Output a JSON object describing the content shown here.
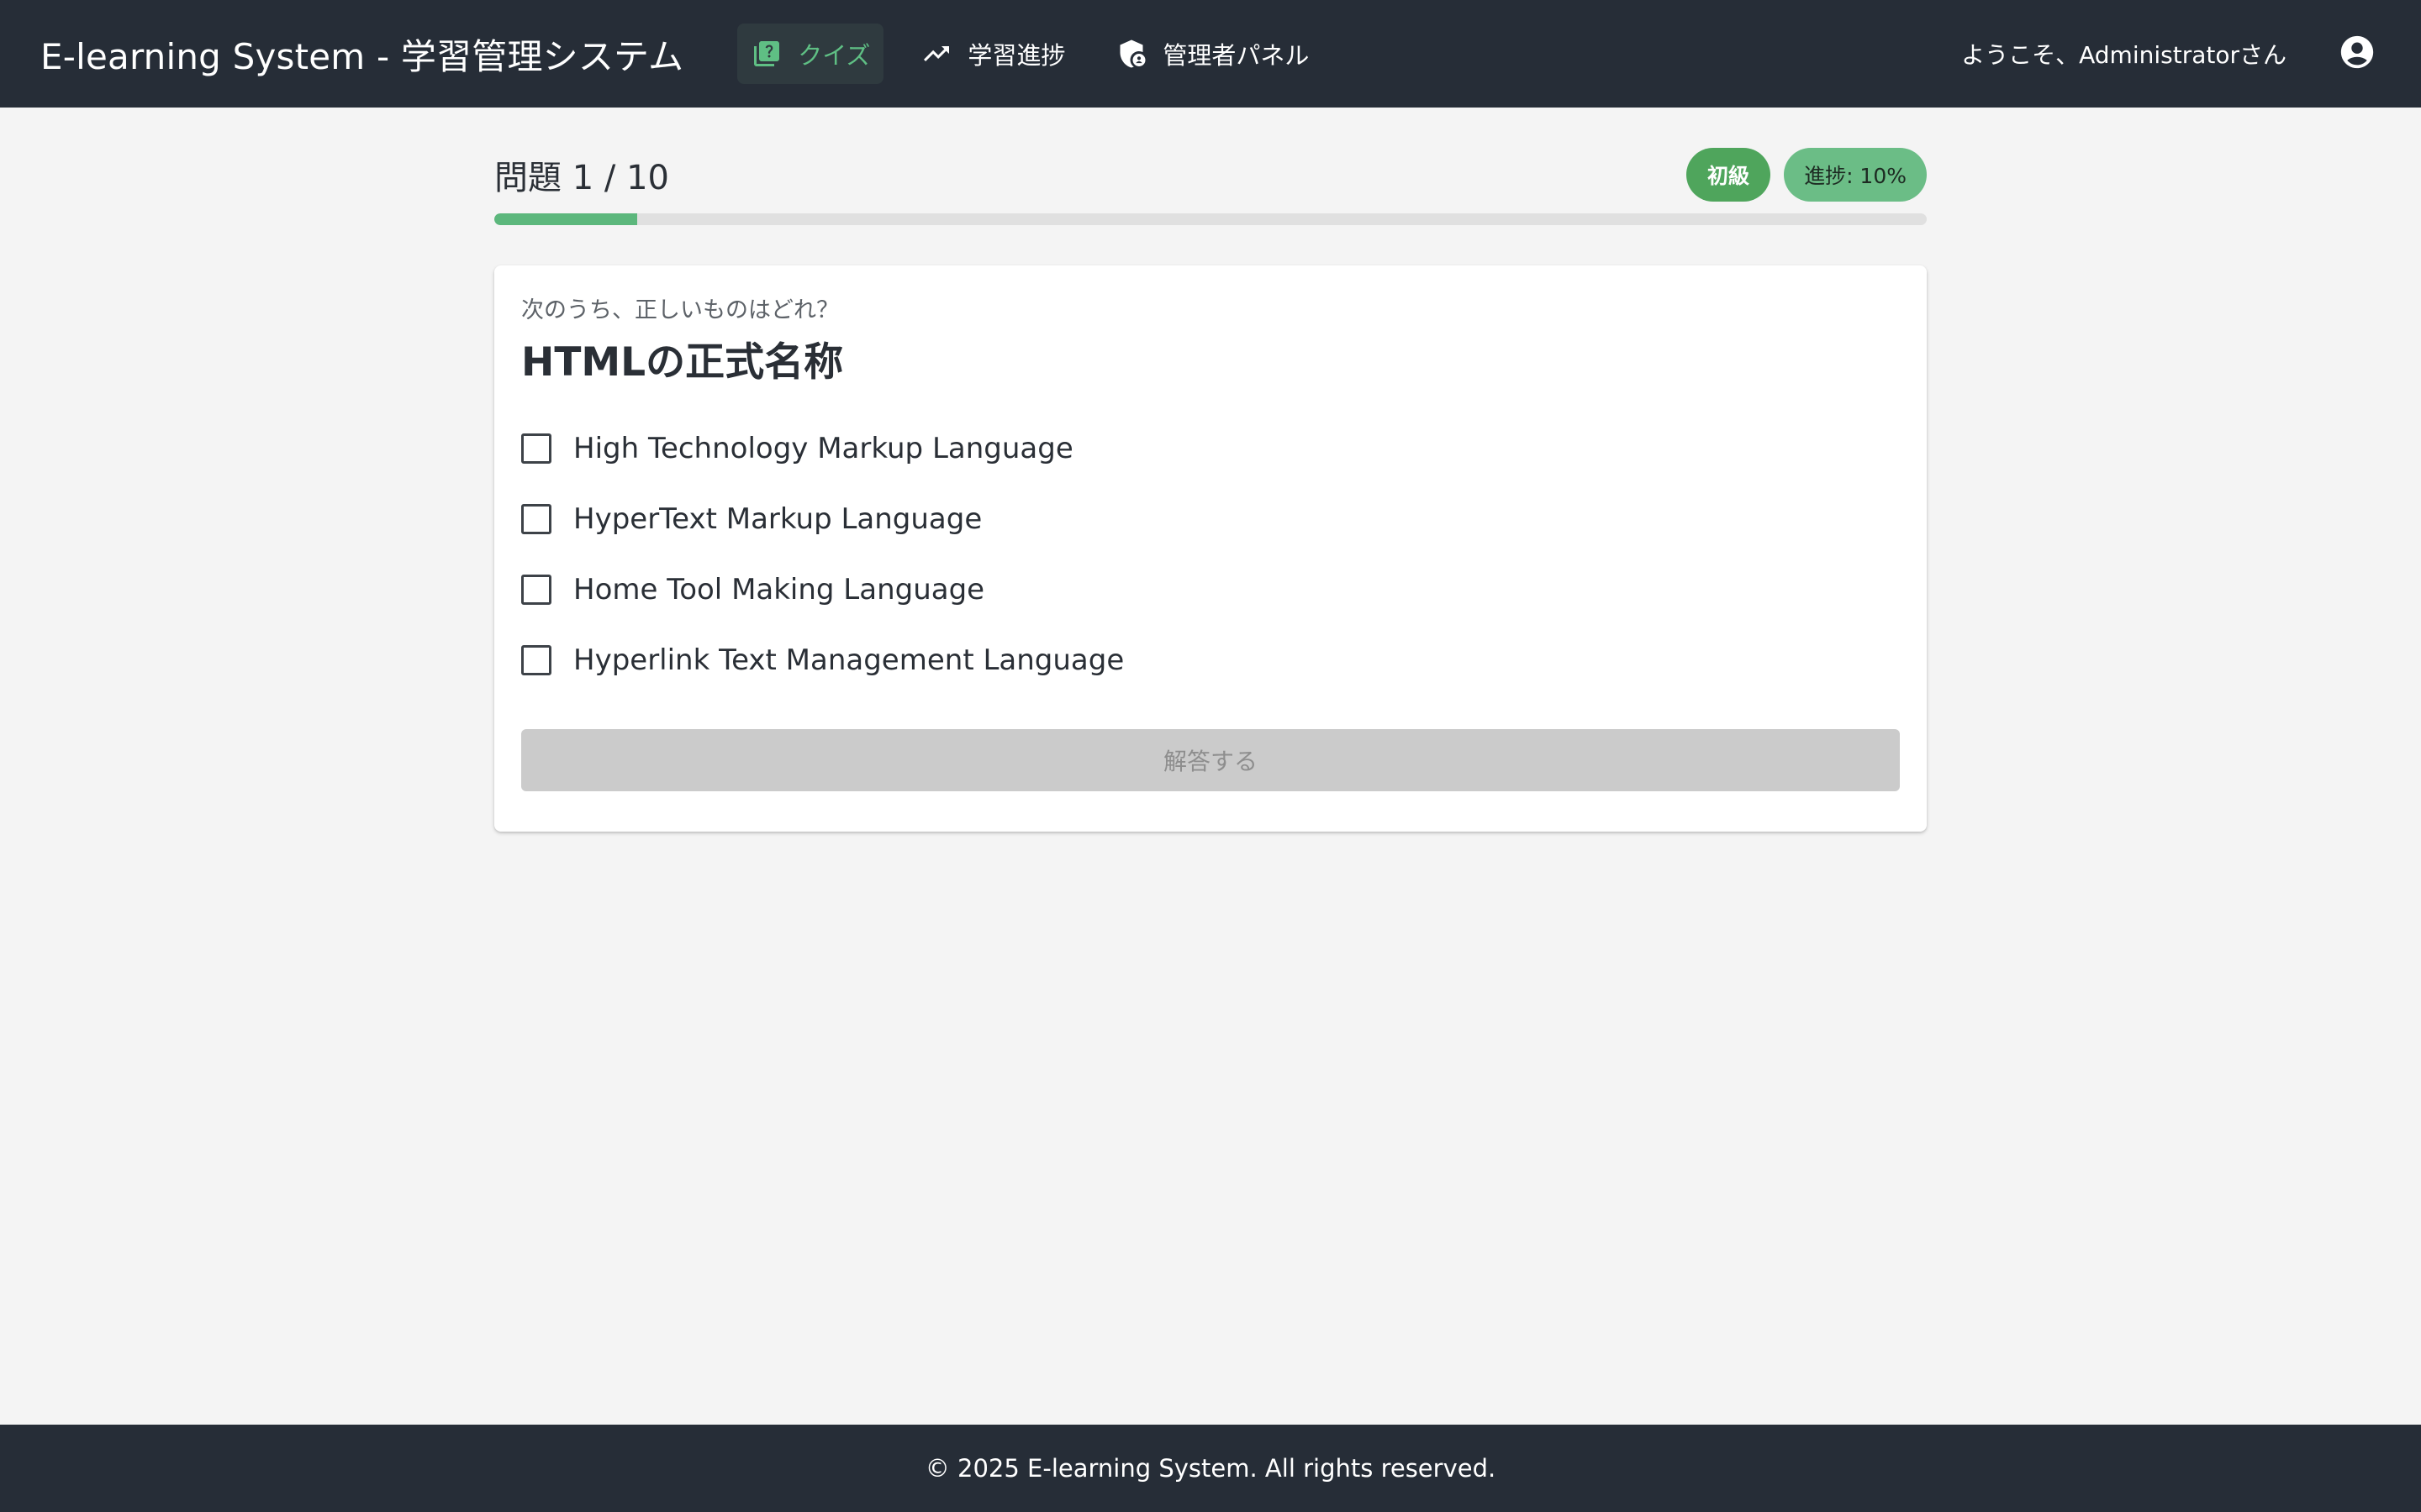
{
  "header": {
    "app_title": "E-learning System - 学習管理システム",
    "nav": [
      {
        "label": "クイズ",
        "icon": "quiz-icon",
        "active": true
      },
      {
        "label": "学習進捗",
        "icon": "trending-up-icon",
        "active": false
      },
      {
        "label": "管理者パネル",
        "icon": "admin-shield-icon",
        "active": false
      }
    ],
    "welcome_text": "ようこそ、Administratorさん",
    "account_icon": "account-circle-icon"
  },
  "quiz": {
    "question_number": "問題 1 / 10",
    "level_badge": "初級",
    "progress_badge": "進捗: 10%",
    "progress_fraction": 0.1,
    "instruction": "次のうち、正しいものはどれ？",
    "question": "HTMLの正式名称",
    "options": [
      {
        "label": "High Technology Markup Language",
        "checked": false
      },
      {
        "label": "HyperText Markup Language",
        "checked": false
      },
      {
        "label": "Home Tool Making Language",
        "checked": false
      },
      {
        "label": "Hyperlink Text Management Language",
        "checked": false
      }
    ],
    "submit_label": "解答する",
    "submit_disabled": true
  },
  "footer": {
    "text": "© 2025 E-learning System. All rights reserved."
  },
  "colors": {
    "header_bg": "#262d37",
    "page_bg": "#f4f4f4",
    "accent_green": "#5cb77c",
    "level_badge_bg": "#4fa55c",
    "progress_badge_bg": "#6bbd86",
    "button_disabled_bg": "#cbcbcb"
  }
}
